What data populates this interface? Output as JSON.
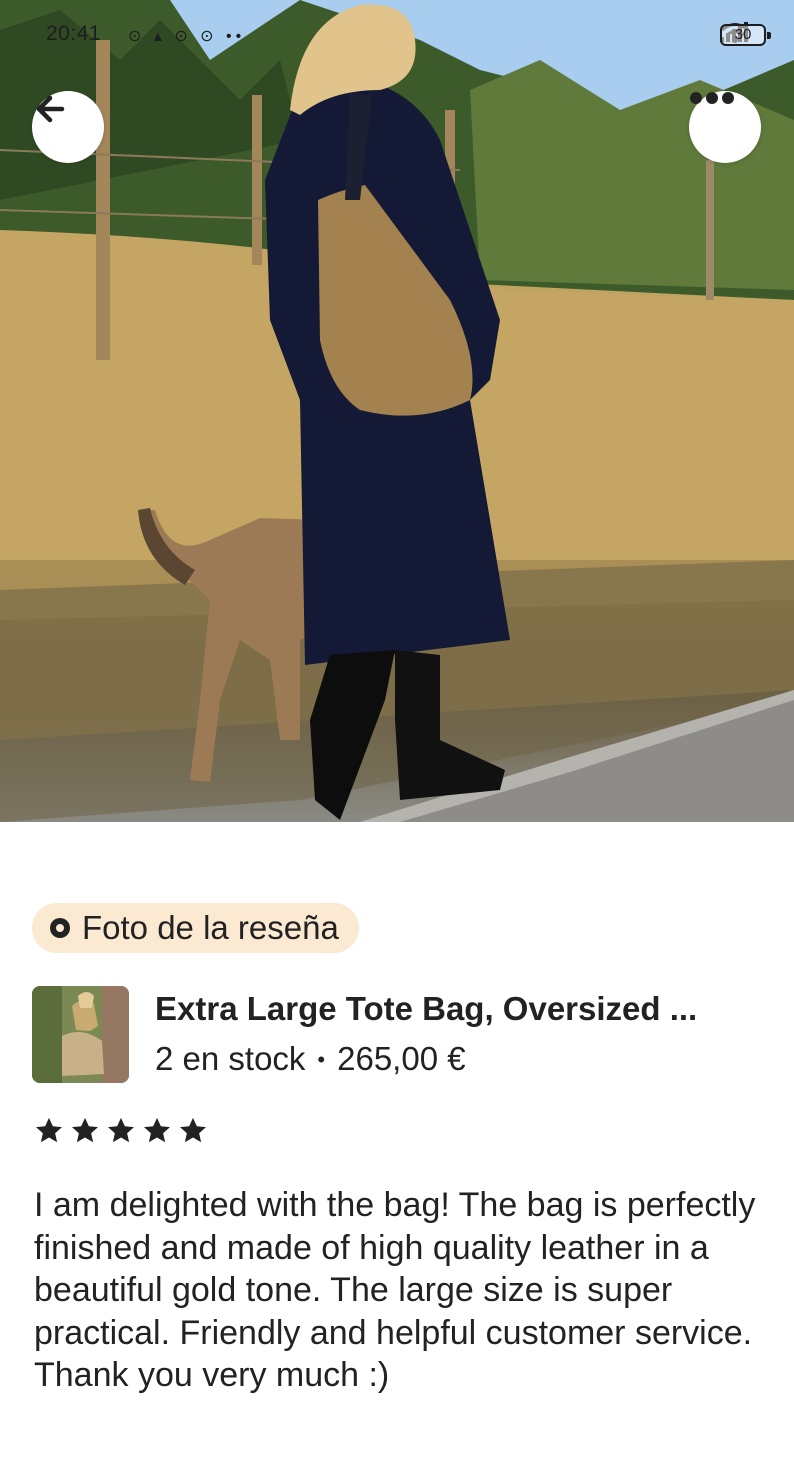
{
  "status_bar": {
    "time": "20:41",
    "left_icons": "⊙ ▴ ⊙ ⊙ ••",
    "battery": "30"
  },
  "photo": {
    "description_icons": [
      "arrow-left-icon",
      "more-icon"
    ]
  },
  "review": {
    "badge_label": "Foto de la reseña",
    "product_title": "Extra Large Tote Bag, Oversized ...",
    "stock": "2 en stock",
    "separator": "•",
    "price": "265,00 €",
    "rating": 5,
    "text": "I am delighted with the bag! The bag is perfectly finished and made of high quality leather in a beautiful gold tone. The large size is super practical. Friendly and helpful customer service. Thank you very much :)"
  },
  "colors": {
    "badge_bg": "#fbe9d1",
    "text": "#222222",
    "star": "#222222"
  }
}
